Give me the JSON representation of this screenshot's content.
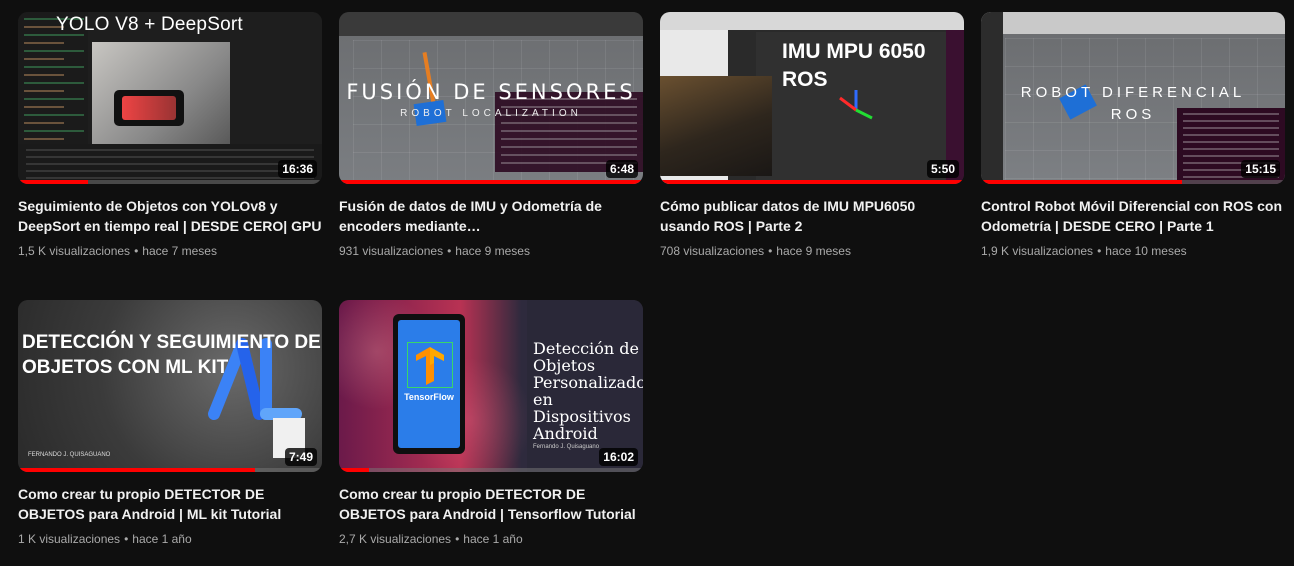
{
  "videos": [
    {
      "thumb_text": "YOLO V8 + DeepSort",
      "duration": "16:36",
      "progress": 0.23,
      "title": "Seguimiento de Objetos con YOLOv8 y DeepSort en tiempo real | DESDE CERO| GPU",
      "views": "1,5 K visualizaciones",
      "age": "hace 7 meses"
    },
    {
      "thumb_text": "FUSIÓN DE SENSORES",
      "thumb_sub": "ROBOT LOCALIZATION",
      "duration": "6:48",
      "progress": 1.0,
      "title": "Fusión de datos de IMU y Odometría de encoders mediante ROBOT_LOCALIZATION…",
      "views": "931 visualizaciones",
      "age": "hace 9 meses"
    },
    {
      "thumb_text_1": "IMU MPU 6050",
      "thumb_text_2": "ROS",
      "duration": "5:50",
      "progress": 1.0,
      "title": "Cómo publicar datos de IMU MPU6050 usando ROS | Parte 2",
      "views": "708 visualizaciones",
      "age": "hace 9 meses"
    },
    {
      "thumb_text_1": "ROBOT DIFERENCIAL",
      "thumb_text_2": "ROS",
      "duration": "15:15",
      "progress": 0.66,
      "title": "Control Robot Móvil Diferencial con ROS con Odometría | DESDE CERO | Parte 1",
      "views": "1,9 K visualizaciones",
      "age": "hace 10 meses"
    },
    {
      "thumb_text": "DETECCIÓN Y SEGUIMIENTO DE OBJETOS CON ML KIT",
      "thumb_author": "FERNANDO J. QUISAGUANO",
      "duration": "7:49",
      "progress": 0.78,
      "title": "Como crear tu propio DETECTOR DE OBJETOS para Android | ML kit Tutorial",
      "views": "1 K visualizaciones",
      "age": "hace 1 año"
    },
    {
      "thumb_text": "Detección de Objetos Personalizados en Dispositivos Android",
      "thumb_logo_label": "TensorFlow",
      "thumb_author": "Fernando J. Quisaguano",
      "duration": "16:02",
      "progress": 0.1,
      "title": "Como crear tu propio DETECTOR DE OBJETOS para Android | Tensorflow Tutorial",
      "views": "2,7 K visualizaciones",
      "age": "hace 1 año"
    }
  ],
  "meta_separator": "•",
  "colors": {
    "background": "#0f0f0f",
    "title": "#f1f1f1",
    "meta": "#aaaaaa",
    "progress": "#ff0000"
  }
}
